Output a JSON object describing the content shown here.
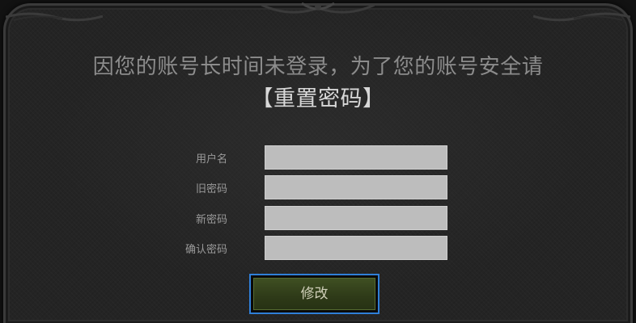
{
  "header": {
    "line1": "因您的账号长时间未登录，为了您的账号安全请",
    "line2": "【重置密码】"
  },
  "form": {
    "fields": [
      {
        "label": "用户名",
        "value": ""
      },
      {
        "label": "旧密码",
        "value": ""
      },
      {
        "label": "新密码",
        "value": ""
      },
      {
        "label": "确认密码",
        "value": ""
      }
    ],
    "submit_label": "修改"
  },
  "colors": {
    "panel": "#242424",
    "input_bg": "#bdbdbd",
    "button_green": "#3f4f22",
    "focus_border": "#2f7fd8"
  }
}
